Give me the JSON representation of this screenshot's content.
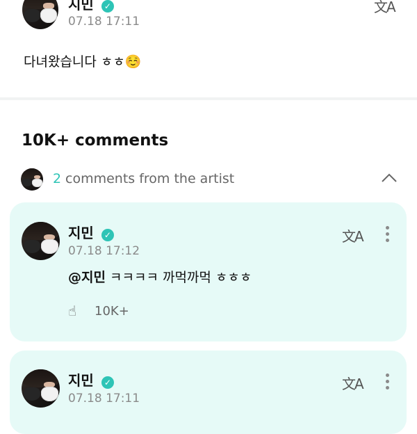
{
  "post": {
    "author": "지민",
    "time": "07.18 17:11",
    "body": "다녀왔습니다 ㅎㅎ☺️",
    "translate_icon": "translate-icon"
  },
  "comments_header": {
    "title": "10K+ comments",
    "artist_count": "2",
    "artist_label": "comments from the artist",
    "collapse_icon": "chevron-up-icon"
  },
  "comments": [
    {
      "author": "지민",
      "time": "07.18 17:12",
      "mention": "@지민",
      "text": " ㅋㅋㅋㅋ 까먹까먹 ㅎㅎㅎ",
      "likes": "10K+"
    },
    {
      "author": "지민",
      "time": "07.18 17:11"
    }
  ],
  "colors": {
    "accent": "#2ec4b6",
    "card_bg": "#e6faf7",
    "muted": "#8a8a8a"
  }
}
